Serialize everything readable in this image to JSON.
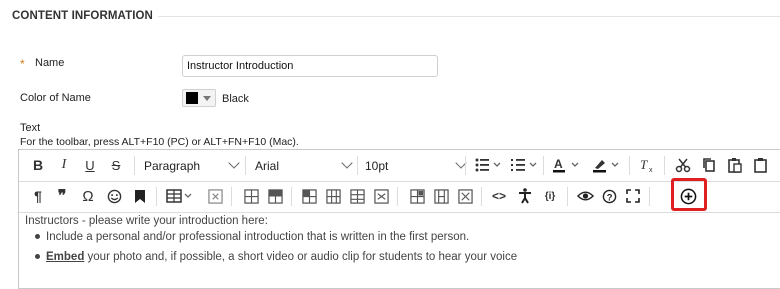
{
  "section": {
    "title": "CONTENT INFORMATION"
  },
  "form": {
    "name_label": "Name",
    "required_marker": "*",
    "name_value": "Instructor Introduction",
    "color_label": "Color of Name",
    "color_value": "Black",
    "color_swatch": "#000000",
    "text_label": "Text",
    "toolbar_hint": "For the toolbar, press ALT+F10 (PC) or ALT+FN+F10 (Mac)."
  },
  "toolbar": {
    "paragraph": "Paragraph",
    "font": "Arial",
    "size": "10pt",
    "row1_icons": [
      "bold-icon",
      "italic-icon",
      "underline-icon",
      "strikethrough-icon",
      "bullet-list-icon",
      "numbered-list-icon",
      "font-color-icon",
      "highlight-color-icon",
      "clear-formatting-icon",
      "cut-icon",
      "copy-icon",
      "paste-icon"
    ],
    "row2_icons": [
      "paragraph-mark-icon",
      "blockquote-icon",
      "special-character-icon",
      "emoticon-icon",
      "bookmark-icon",
      "table-icon",
      "table-delete-icon",
      "table-insert-row-before-icon",
      "table-insert-row-after-icon",
      "table-delete-row-icon",
      "table-insert-column-before-icon",
      "table-insert-column-after-icon",
      "table-delete-column-icon",
      "table-split-cell-icon",
      "table-merge-cells-icon",
      "table-cell-props-icon",
      "source-code-icon",
      "accessibility-icon",
      "math-formula-icon",
      "preview-icon",
      "help-icon",
      "fullscreen-icon",
      "add-content-icon"
    ],
    "highlight_color": "#e02020"
  },
  "content": {
    "intro": "Instructors - please write your introduction here:",
    "bullet1": "Include a personal and/or professional introduction that is written in the first person.",
    "bullet2_link": "Embed",
    "bullet2_rest": " your photo and, if possible, a short video or audio clip for students to hear your voice"
  }
}
